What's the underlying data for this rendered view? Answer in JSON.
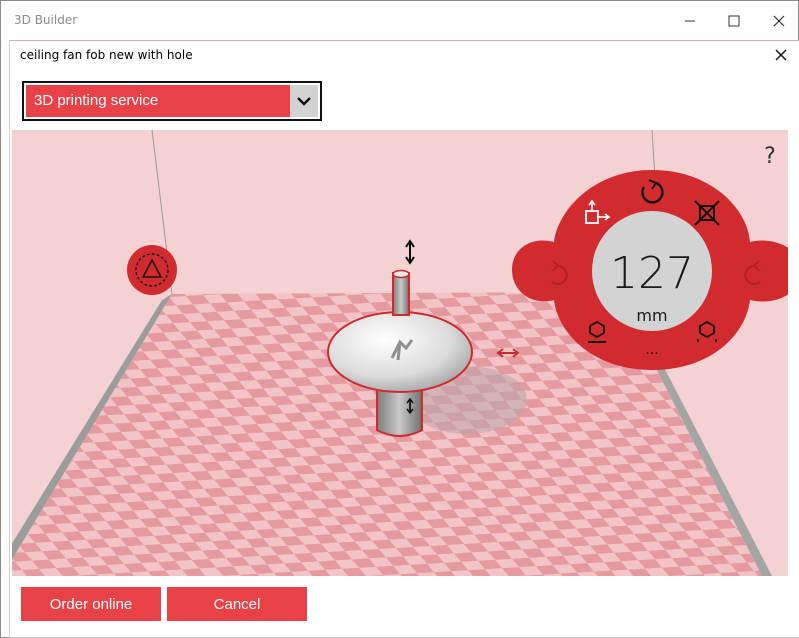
{
  "window": {
    "title": "3D Builder"
  },
  "dialog": {
    "title": "ceiling fan fob new with hole",
    "service_option": "3D printing service"
  },
  "viewport": {
    "help_label": "?",
    "size_value": "127",
    "size_unit": "mm",
    "more_label": "..."
  },
  "footer": {
    "order_label": "Order online",
    "cancel_label": "Cancel"
  },
  "colors": {
    "accent": "#e84148",
    "ring": "#d12b30",
    "floor_light": "#f3c4c7",
    "floor_dark": "#e59a9f"
  }
}
